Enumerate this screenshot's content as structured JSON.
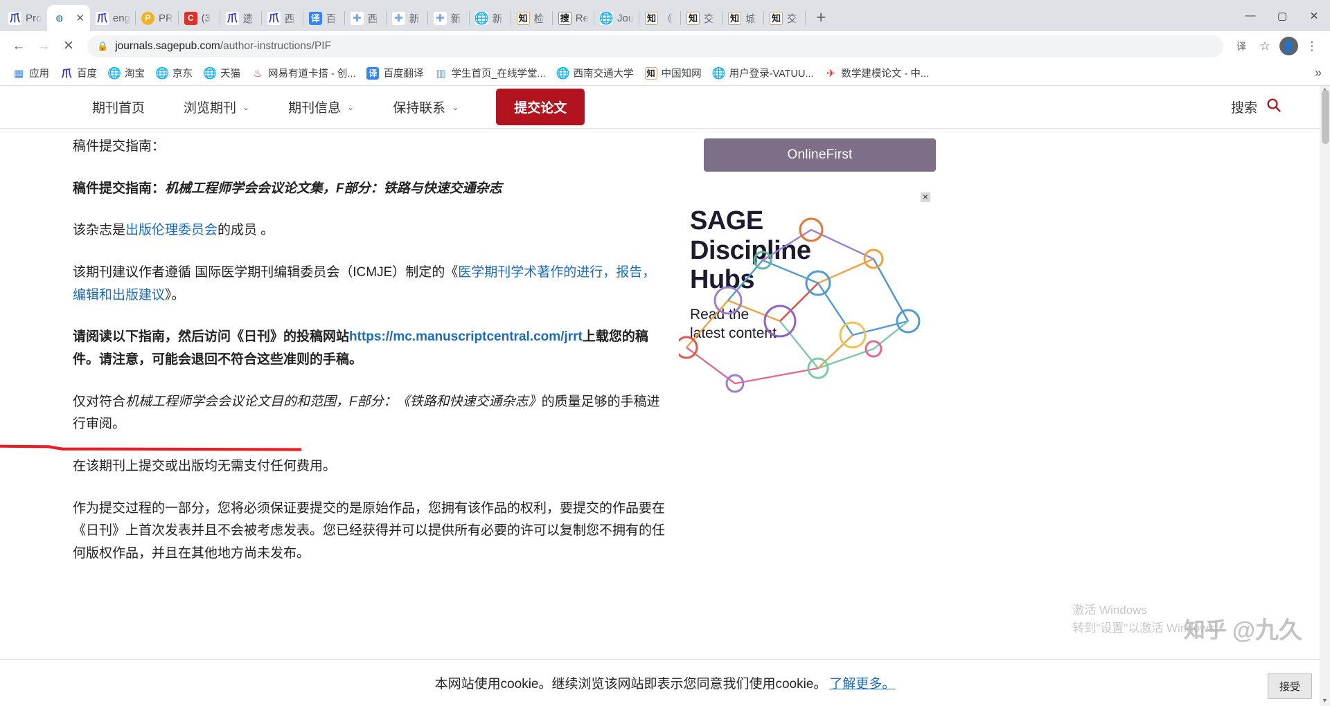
{
  "window": {
    "minimize": "—",
    "maximize": "▢",
    "close": "✕"
  },
  "tabstrip": {
    "new_tab_label": "+",
    "tabs": [
      {
        "title": "Pro",
        "icon": "baidu-icon",
        "icon_glyph": "爪",
        "active": false
      },
      {
        "title": "",
        "icon": "sage-icon",
        "icon_glyph": "◍",
        "active": true,
        "close_label": "✕"
      },
      {
        "title": "eng",
        "icon": "baidu-icon",
        "icon_glyph": "爪",
        "active": false
      },
      {
        "title": "PR",
        "icon": "p-circle-icon",
        "icon_glyph": "P",
        "active": false
      },
      {
        "title": "(3",
        "icon": "c-square-icon",
        "icon_glyph": "C",
        "active": false
      },
      {
        "title": "遗",
        "icon": "baidu-icon",
        "icon_glyph": "爪",
        "active": false
      },
      {
        "title": "西",
        "icon": "baidu-icon",
        "icon_glyph": "爪",
        "active": false
      },
      {
        "title": "百",
        "icon": "fanyi-icon",
        "icon_glyph": "译",
        "active": false
      },
      {
        "title": "西",
        "icon": "edu-shield-icon",
        "icon_glyph": "✚",
        "active": false
      },
      {
        "title": "新",
        "icon": "edu-shield-icon",
        "icon_glyph": "✚",
        "active": false
      },
      {
        "title": "新",
        "icon": "edu-shield-icon",
        "icon_glyph": "✚",
        "active": false
      },
      {
        "title": "新",
        "icon": "globe-icon",
        "icon_glyph": "🌐",
        "active": false
      },
      {
        "title": "检",
        "icon": "cnki-icon",
        "icon_glyph": "知",
        "active": false
      },
      {
        "title": "Re",
        "icon": "sogou-icon",
        "icon_glyph": "搜",
        "active": false
      },
      {
        "title": "Jou",
        "icon": "globe-icon",
        "icon_glyph": "🌐",
        "active": false
      },
      {
        "title": "《",
        "icon": "cnki-icon",
        "icon_glyph": "知",
        "active": false
      },
      {
        "title": "交",
        "icon": "cnki-icon",
        "icon_glyph": "知",
        "active": false
      },
      {
        "title": "城",
        "icon": "cnki-icon",
        "icon_glyph": "知",
        "active": false
      },
      {
        "title": "交",
        "icon": "cnki-icon",
        "icon_glyph": "知",
        "active": false
      }
    ]
  },
  "toolbar": {
    "back_label": "←",
    "forward_label": "→",
    "stop_label": "✕",
    "lock_icon": "🔒",
    "url_host": "journals.sagepub.com",
    "url_path": "/author-instructions/PIF",
    "translate_label": "译",
    "bookmark_star": "☆",
    "profile_label": "●",
    "menu_label": "⋮"
  },
  "bookmarks": {
    "overflow_label": "»",
    "items": [
      {
        "label": "应用",
        "icon": "apps-grid-icon",
        "glyph": "▦"
      },
      {
        "label": "百度",
        "icon": "baidu-icon",
        "glyph": "爪"
      },
      {
        "label": "淘宝",
        "icon": "globe-icon",
        "glyph": "🌐"
      },
      {
        "label": "京东",
        "icon": "globe-icon",
        "glyph": "🌐"
      },
      {
        "label": "天猫",
        "icon": "globe-icon",
        "glyph": "🌐"
      },
      {
        "label": "网易有道卡搭 - 创...",
        "icon": "youdao-icon",
        "glyph": "♨"
      },
      {
        "label": "百度翻译",
        "icon": "fanyi-icon",
        "glyph": "译"
      },
      {
        "label": "学生首页_在线学堂...",
        "icon": "chart-icon",
        "glyph": "▥"
      },
      {
        "label": "西南交通大学",
        "icon": "globe-icon",
        "glyph": "🌐"
      },
      {
        "label": "中国知网",
        "icon": "cnki-icon",
        "glyph": "知"
      },
      {
        "label": "用户登录-VATUU...",
        "icon": "globe-icon",
        "glyph": "🌐"
      },
      {
        "label": "数学建模论文 - 中...",
        "icon": "red-bird-icon",
        "glyph": "✈"
      }
    ]
  },
  "site_nav": {
    "links": [
      {
        "label": "期刊首页",
        "has_caret": false
      },
      {
        "label": "浏览期刊",
        "has_caret": true,
        "caret": "⌄"
      },
      {
        "label": "期刊信息",
        "has_caret": true,
        "caret": "⌄"
      },
      {
        "label": "保持联系",
        "has_caret": true,
        "caret": "⌄"
      }
    ],
    "submit_button": "提交论文",
    "search_label": "搜索",
    "search_icon": "search-icon"
  },
  "article": {
    "paragraphs": [
      {
        "id": "p1",
        "bold": false,
        "runs": [
          {
            "t": "稿件提交指南："
          }
        ]
      },
      {
        "id": "p2",
        "bold": true,
        "runs": [
          {
            "t": "稿件提交指南："
          },
          {
            "t": "机械工程师学会会议论文集，F部分：铁路与快速交通杂志",
            "style": "em"
          }
        ]
      },
      {
        "id": "p3",
        "bold": false,
        "runs": [
          {
            "t": "该杂志是"
          },
          {
            "t": "出版伦理委员会",
            "style": "link"
          },
          {
            "t": "的成员 。"
          }
        ]
      },
      {
        "id": "p4",
        "bold": false,
        "runs": [
          {
            "t": "该期刊建议作者遵循 国际医学期刊编辑委员会（ICMJE）制定的《"
          },
          {
            "t": "医学期刊学术著作的进行，报告，编辑和出版建议",
            "style": "link"
          },
          {
            "t": "》。"
          }
        ]
      },
      {
        "id": "p5",
        "bold": true,
        "runs": [
          {
            "t": "请阅读以下指南，然后访问《日刊》的投稿网站"
          },
          {
            "t": "https://mc.manuscriptcentral.com/jrrt",
            "style": "link-b"
          },
          {
            "t": "上载您的稿件。请注意，可能会退回不符合这些准则的手稿。"
          }
        ]
      },
      {
        "id": "p6",
        "bold": false,
        "runs": [
          {
            "t": "仅对符合"
          },
          {
            "t": "机械工程师学会会议论文目的和范围，F部分：《铁路和快速交通杂志》",
            "style": "em-norm"
          },
          {
            "t": "的质量足够的手稿进行审阅。"
          }
        ]
      },
      {
        "id": "p7",
        "bold": false,
        "runs": [
          {
            "t": "在该期刊上提交或出版均无需支付任何费用。"
          }
        ]
      },
      {
        "id": "p8",
        "bold": false,
        "runs": [
          {
            "t": "作为提交过程的一部分，您将必须保证要提交的是原始作品，您拥有该作品的权利，要提交的作品要在《日刊》上首次发表并且不会被考虑发表。您已经获得并可以提供所有必要的许可以复制您不拥有的任何版权作品，并且在其他地方尚未发布。"
          }
        ]
      }
    ],
    "annotation_color": "#ee1c25"
  },
  "sidebar": {
    "online_first_button": "OnlineFirst",
    "ad": {
      "close_label": "✕",
      "heading_lines": [
        "SAGE",
        "Discipline",
        "Hubs"
      ],
      "sub_lines": [
        "Read the",
        "latest content"
      ]
    }
  },
  "cookie_banner": {
    "text": "本网站使用cookie。继续浏览该网站即表示您同意我们使用cookie。",
    "link": "了解更多。",
    "accept_button": "接受"
  },
  "watermark": {
    "logo": "知乎",
    "handle": "@九久",
    "activate_line1": "激活 Windows",
    "activate_line2": "转到\"设置\"以激活 Windows。"
  },
  "colors": {
    "accent_red": "#b3131f",
    "link_blue": "#1a6bbd",
    "sidebar_purple": "#7d6f87",
    "annotation_red": "#ee1c25"
  }
}
